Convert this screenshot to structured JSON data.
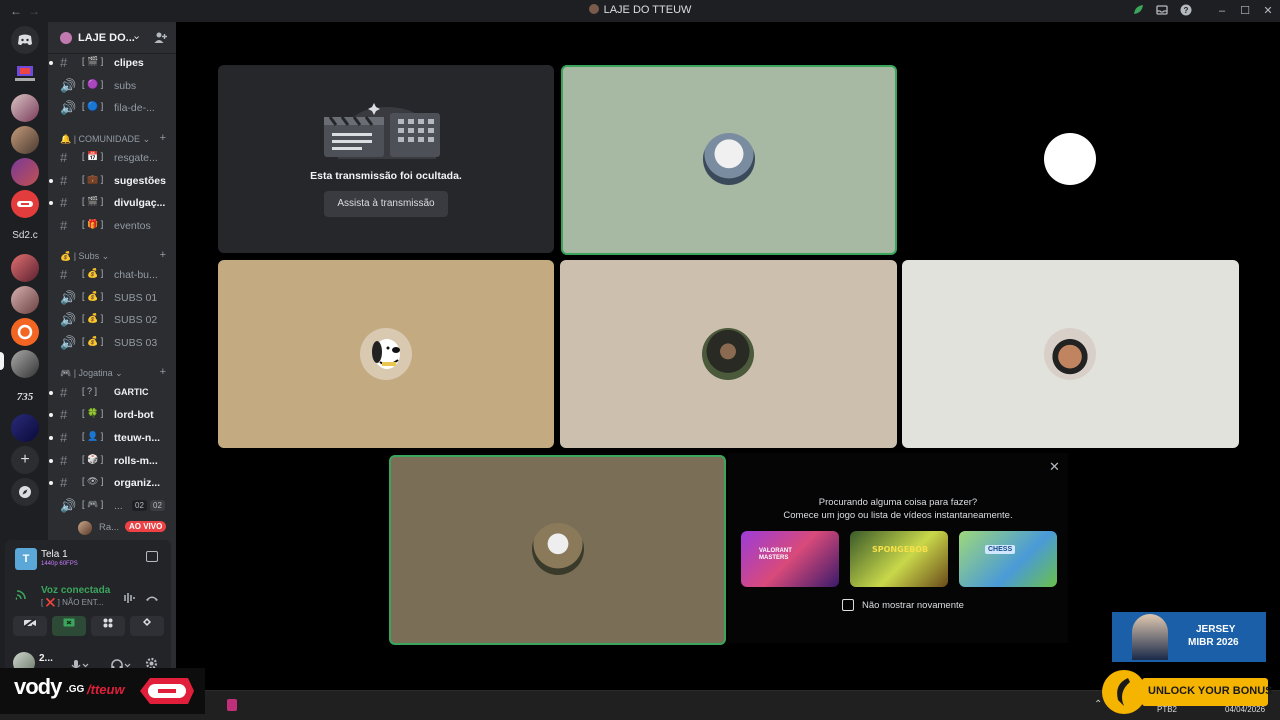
{
  "window": {
    "title": "LAJE DO TTEUW",
    "back_glyph": "←",
    "forward_glyph": "→",
    "minimize_glyph": "–",
    "maximize_glyph": "☐",
    "close_glyph": "✕"
  },
  "servers": [
    {
      "label": "Sd2.c"
    }
  ],
  "guild": {
    "name": "LAJE DO...",
    "chevron": "⌄"
  },
  "channels": [
    {
      "type": "text",
      "prefix": "[ 🎬 ]",
      "name": "clipes",
      "bold": true
    },
    {
      "type": "voice",
      "prefix": "[ 🟣 ]",
      "name": "subs",
      "bold": false
    },
    {
      "type": "voice",
      "prefix": "[ 🔵 ]",
      "name": "fila-de-...",
      "bold": false
    }
  ],
  "categories": {
    "comunidade": "| COMUNIDADE",
    "subs": "| Subs",
    "jogatina": "| Jogatina"
  },
  "channels_comunidade": [
    {
      "type": "text",
      "prefix": "[ 📅 ]",
      "name": "resgate...",
      "bold": false
    },
    {
      "type": "text",
      "prefix": "[ 💼 ]",
      "name": "sugestões",
      "bold": true
    },
    {
      "type": "text",
      "prefix": "[ 🎬 ]",
      "name": "divulgaç...",
      "bold": true
    },
    {
      "type": "text",
      "prefix": "[ 🎁 ]",
      "name": "eventos",
      "bold": false
    }
  ],
  "channels_subs": [
    {
      "type": "text",
      "prefix": "[ 💰 ]",
      "name": "chat-bu...",
      "bold": false
    },
    {
      "type": "voice",
      "prefix": "[ 💰 ]",
      "name": "SUBS 01",
      "bold": false
    },
    {
      "type": "voice",
      "prefix": "[ 💰 ]",
      "name": "SUBS 02",
      "bold": false
    },
    {
      "type": "voice",
      "prefix": "[ 💰 ]",
      "name": "SUBS 03",
      "bold": false
    }
  ],
  "channels_jogatina": [
    {
      "type": "text",
      "prefix": "[ ? ]",
      "name": "GARTIC",
      "bold": true
    },
    {
      "type": "text",
      "prefix": "[ 🍀 ]",
      "name": "lord-bot",
      "bold": true
    },
    {
      "type": "text",
      "prefix": "[ 👤 ]",
      "name": "tteuw-n...",
      "bold": true
    },
    {
      "type": "text",
      "prefix": "[ 🎲 ]",
      "name": "rolls-m...",
      "bold": true
    },
    {
      "type": "text",
      "prefix": "[ 👁 ]",
      "name": "organiz...",
      "bold": true
    }
  ],
  "active_voice": {
    "prefix": "[ 🎮 ]",
    "name": "...",
    "count_left": "02",
    "count_right": "02",
    "member_name": "Ra...",
    "live_badge": "AO VIVO"
  },
  "stream_panel": {
    "title": "Tela 1",
    "quality": "1440p 60FPS"
  },
  "voice_panel": {
    "status": "Voz conectada",
    "channel": "[ ❌ ] NÃO ENT..."
  },
  "user": {
    "name": "2..."
  },
  "stage": {
    "hidden_title": "Esta transmissão foi ocultada.",
    "watch_button": "Assista à transmissão"
  },
  "suggestions": {
    "title": "Procurando alguma coisa para fazer?",
    "subtitle": "Comece um jogo ou lista de vídeos instantaneamente.",
    "checkbox_label": "Não mostrar novamente",
    "thumbs": [
      {
        "label": "VALORANT MASTERS"
      },
      {
        "label": "SPONGEBOB"
      },
      {
        "label": "CHESS"
      }
    ]
  },
  "overlay": {
    "vody_brand": "vody",
    "vody_domain": ".GG",
    "vody_handle": "/tteuw",
    "mibr_line1": "JERSEY",
    "mibr_line2": "MIBR 2026",
    "bonus": "UNLOCK YOUR BONUS"
  },
  "taskbar": {
    "lang": "PTB2",
    "date": "04/04/2026"
  },
  "colors": {
    "speaking": "#3ba55c",
    "tile_green": "#a7b8a3",
    "tile_tan": "#c4aa81",
    "tile_beige": "#ccbfae",
    "tile_gray": "#e2e2dc",
    "tile_olive": "#7b6e57",
    "live": "#ed4245"
  }
}
